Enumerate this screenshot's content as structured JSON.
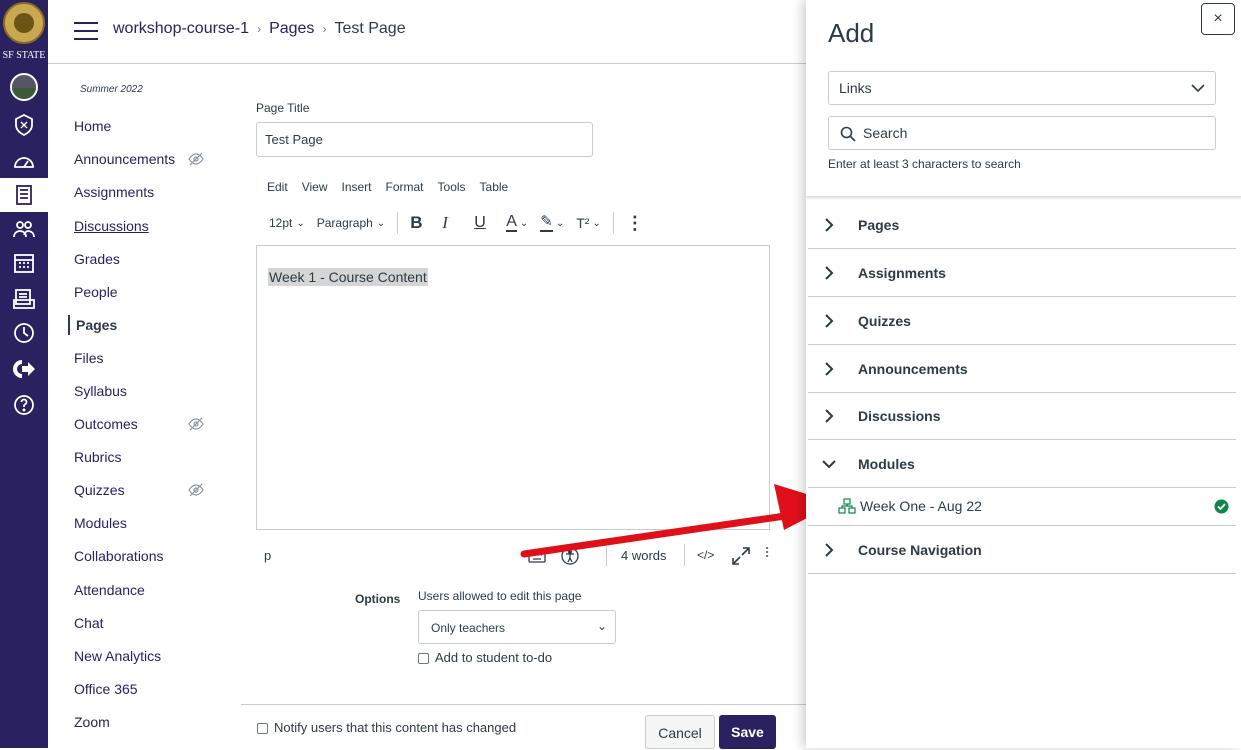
{
  "global_nav": {
    "logo_text": "SF STATE",
    "items": [
      "avatar",
      "admin-icon",
      "dashboard-icon",
      "courses-icon",
      "groups-icon",
      "calendar-icon",
      "inbox-icon",
      "history-icon",
      "logout-icon",
      "help-icon"
    ]
  },
  "breadcrumb": {
    "course": "workshop-course-1",
    "section": "Pages",
    "page": "Test Page"
  },
  "course_nav": {
    "term": "Summer 2022",
    "items": [
      {
        "label": "Home"
      },
      {
        "label": "Announcements",
        "hidden": true
      },
      {
        "label": "Assignments"
      },
      {
        "label": "Discussions"
      },
      {
        "label": "Grades"
      },
      {
        "label": "People"
      },
      {
        "label": "Pages",
        "active": true
      },
      {
        "label": "Files"
      },
      {
        "label": "Syllabus"
      },
      {
        "label": "Outcomes",
        "hidden": true
      },
      {
        "label": "Rubrics"
      },
      {
        "label": "Quizzes",
        "hidden": true
      },
      {
        "label": "Modules"
      },
      {
        "label": "Collaborations"
      },
      {
        "label": "Attendance"
      },
      {
        "label": "Chat"
      },
      {
        "label": "New Analytics"
      },
      {
        "label": "Office 365"
      },
      {
        "label": "Zoom"
      }
    ]
  },
  "editor": {
    "title_label": "Page Title",
    "title_value": "Test Page",
    "menubar": [
      "Edit",
      "View",
      "Insert",
      "Format",
      "Tools",
      "Table"
    ],
    "font_size": "12pt",
    "block_format": "Paragraph",
    "body_text": "Week 1 - Course Content",
    "status_path": "p",
    "word_count": "4 words",
    "html_toggle": "</>"
  },
  "options": {
    "label": "Options",
    "edit_label": "Users allowed to edit this page",
    "edit_value": "Only teachers",
    "todo_label": "Add to student to-do"
  },
  "footer": {
    "notify_label": "Notify users that this content has changed",
    "cancel": "Cancel",
    "save": "Save"
  },
  "tray": {
    "title": "Add",
    "close": "×",
    "type_select": "Links",
    "search_placeholder": "Search",
    "hint": "Enter at least 3 characters to search",
    "sections": [
      "Pages",
      "Assignments",
      "Quizzes",
      "Announcements",
      "Discussions",
      "Modules",
      "Course Navigation"
    ],
    "expanded_section": "Modules",
    "module_item": "Week One - Aug 22"
  },
  "colors": {
    "brand": "#2a2160",
    "success": "#0b874b",
    "arrow": "#e0101a"
  }
}
